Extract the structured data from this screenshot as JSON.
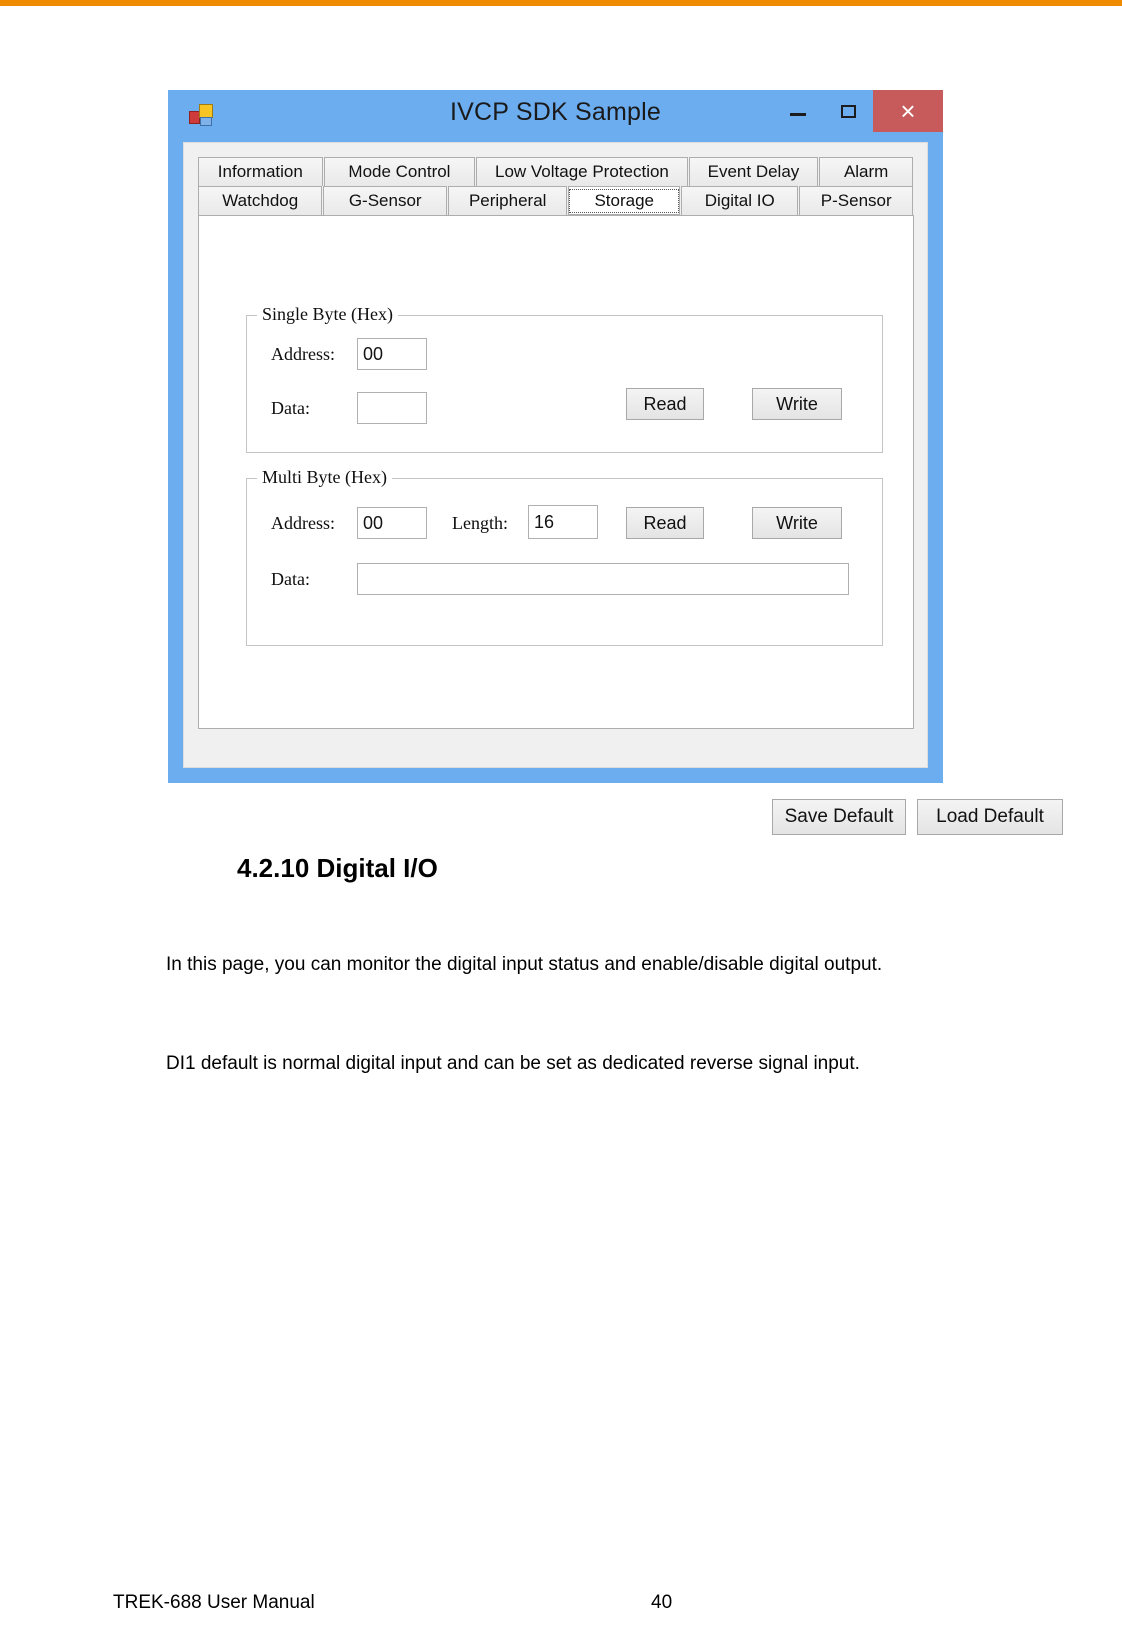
{
  "page": {
    "top_rule_color": "#f08a00",
    "footer_left": "TREK-688 User Manual",
    "footer_page": "40"
  },
  "window": {
    "title": "IVCP SDK Sample",
    "icon": "app-windows-forms-icon",
    "titlebar_color": "#6cadf0",
    "close_color": "#c75b5b",
    "controls": {
      "minimize": "–",
      "maximize": "□",
      "close": "×"
    }
  },
  "tabs": {
    "row1": [
      {
        "label": "Information",
        "selected": false
      },
      {
        "label": "Mode Control",
        "selected": false
      },
      {
        "label": "Low Voltage Protection",
        "selected": false
      },
      {
        "label": "Event Delay",
        "selected": false
      },
      {
        "label": "Alarm",
        "selected": false
      }
    ],
    "row2": [
      {
        "label": "Watchdog",
        "selected": false
      },
      {
        "label": "G-Sensor",
        "selected": false
      },
      {
        "label": "Peripheral",
        "selected": false
      },
      {
        "label": "Storage",
        "selected": true
      },
      {
        "label": "Digital IO",
        "selected": false
      },
      {
        "label": "P-Sensor",
        "selected": false
      }
    ]
  },
  "single_byte": {
    "title": "Single Byte (Hex)",
    "address_label": "Address:",
    "address_value": "00",
    "data_label": "Data:",
    "data_value": "",
    "read_label": "Read",
    "write_label": "Write"
  },
  "multi_byte": {
    "title": "Multi Byte (Hex)",
    "address_label": "Address:",
    "address_value": "00",
    "length_label": "Length:",
    "length_value": "16",
    "data_label": "Data:",
    "data_value": "",
    "read_label": "Read",
    "write_label": "Write"
  },
  "footer_buttons": {
    "save_default": "Save Default",
    "load_default": "Load Default"
  },
  "document": {
    "heading": "4.2.10 Digital I/O",
    "paragraph_1": "In this page, you can monitor the digital input status and enable/disable digital output.",
    "paragraph_2": "DI1 default is normal digital input and can be set as dedicated reverse signal input."
  }
}
